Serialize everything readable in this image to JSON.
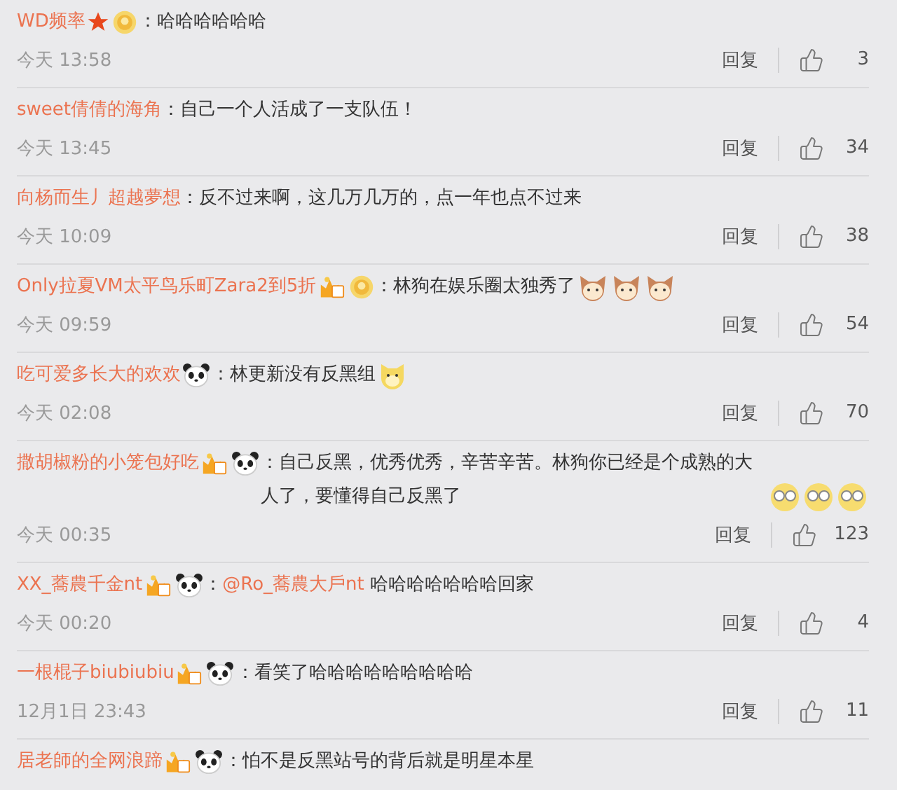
{
  "comments": [
    {
      "user": "WD频率",
      "badges": [
        {
          "kind": "star"
        },
        {
          "kind": "medal"
        }
      ],
      "body": [
        {
          "kind": "plain",
          "text": "：哈哈哈哈哈哈"
        }
      ],
      "time": "今天 13:58",
      "reply": "回复",
      "likes": "3"
    },
    {
      "user": "sweet倩倩的海角",
      "body": [
        {
          "kind": "plain",
          "text": "：自己一个人活成了一支队伍！"
        }
      ],
      "time": "今天 13:45",
      "reply": "回复",
      "likes": "34"
    },
    {
      "user": "向杨而生丿超越夢想",
      "body": [
        {
          "kind": "plain",
          "text": "：反不过来啊，这几万几万的，点一年也点不过来"
        }
      ],
      "time": "今天 10:09",
      "reply": "回复",
      "likes": "38"
    },
    {
      "user": "Only拉夏VM太平鸟乐町Zara2到5折",
      "badges": [
        {
          "kind": "fan"
        },
        {
          "kind": "medal"
        }
      ],
      "body": [
        {
          "kind": "plain",
          "text": "：林狗在娱乐圈太独秀了"
        }
      ],
      "emojis": [
        {
          "kind": "cat"
        },
        {
          "kind": "cat"
        },
        {
          "kind": "cat"
        }
      ],
      "time": "今天 09:59",
      "reply": "回复",
      "likes": "54"
    },
    {
      "user": "吃可爱多长大的欢欢",
      "badges": [
        {
          "kind": "panda"
        }
      ],
      "body": [
        {
          "kind": "plain",
          "text": "：林更新没有反黑组"
        }
      ],
      "emojis": [
        {
          "kind": "dog"
        }
      ],
      "time": "今天 02:08",
      "reply": "回复",
      "likes": "70"
    },
    {
      "user": "撒胡椒粉的小笼包好吃",
      "badges": [
        {
          "kind": "fan"
        },
        {
          "kind": "panda"
        }
      ],
      "body": [
        {
          "kind": "plain",
          "text": "：自己反黑，优秀优秀，辛苦辛苦。林狗你已经是个成熟的大人了，要懂得自己反黑了"
        }
      ],
      "emojis": [
        {
          "kind": "glasses"
        },
        {
          "kind": "glasses"
        },
        {
          "kind": "glasses"
        }
      ],
      "time": "今天 00:35",
      "reply": "回复",
      "likes": "123"
    },
    {
      "user": "XX_蕎農千金nt",
      "badges": [
        {
          "kind": "fan"
        },
        {
          "kind": "panda"
        }
      ],
      "body": [
        {
          "kind": "plain",
          "text": "："
        },
        {
          "kind": "mention",
          "text": "@Ro_蕎農大戶nt"
        },
        {
          "kind": "plain",
          "text": " 哈哈哈哈哈哈哈回家"
        }
      ],
      "time": "今天 00:20",
      "reply": "回复",
      "likes": "4"
    },
    {
      "user": "一根棍子biubiubiu",
      "badges": [
        {
          "kind": "fan"
        },
        {
          "kind": "panda"
        }
      ],
      "body": [
        {
          "kind": "plain",
          "text": "：看笑了哈哈哈哈哈哈哈哈哈"
        }
      ],
      "time": "12月1日 23:43",
      "reply": "回复",
      "likes": "11"
    },
    {
      "user": "居老師的全网浪蹄",
      "badges": [
        {
          "kind": "fan"
        },
        {
          "kind": "panda"
        }
      ],
      "body": [
        {
          "kind": "plain",
          "text": "：怕不是反黑站号的背后就是明星本星"
        }
      ]
    }
  ]
}
